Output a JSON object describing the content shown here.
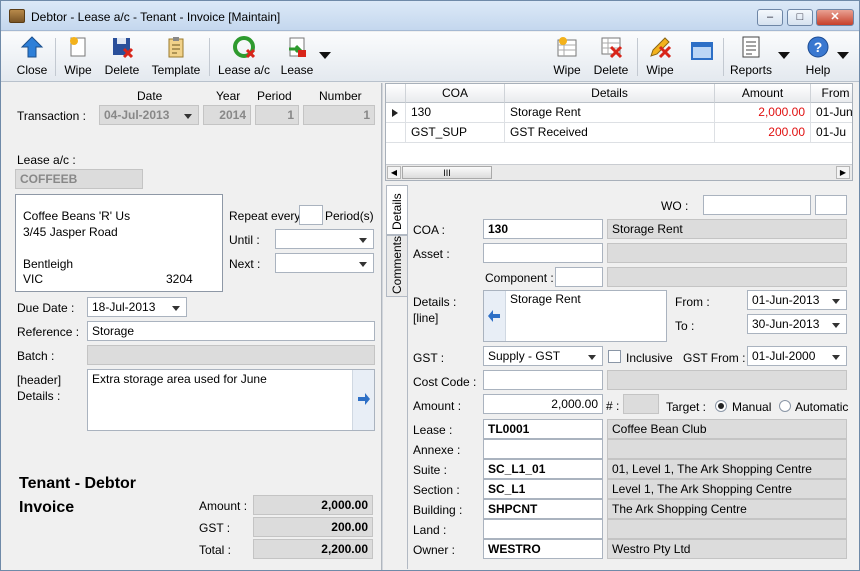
{
  "window": {
    "title": "Debtor - Lease a/c - Tenant - Invoice [Maintain]",
    "min": "–",
    "max": "□",
    "close": "✕"
  },
  "toolbar": {
    "close": "Close",
    "wipe": "Wipe",
    "delete": "Delete",
    "template": "Template",
    "lease_ac": "Lease a/c",
    "lease": "Lease",
    "line_wipe": "Wipe",
    "line_delete": "Delete",
    "wipe2": "Wipe",
    "reports": "Reports",
    "help": "Help"
  },
  "transaction": {
    "label": "Transaction :",
    "date_h": "Date",
    "year_h": "Year",
    "period_h": "Period",
    "number_h": "Number",
    "date": "04-Jul-2013",
    "year": "2014",
    "period": "1",
    "number": "1"
  },
  "lease_ac": {
    "label": "Lease a/c :",
    "value": "COFFEEB"
  },
  "address": {
    "line1": "Coffee Beans 'R' Us",
    "line2": "3/45 Jasper Road",
    "line3": "",
    "suburb": "Bentleigh",
    "state": "VIC",
    "postcode": "3204"
  },
  "repeat": {
    "label": "Repeat every",
    "value": "",
    "suffix": "Period(s)",
    "until_label": "Until :",
    "until": "",
    "next_label": "Next :",
    "next": ""
  },
  "due_date": {
    "label": "Due Date :",
    "value": "18-Jul-2013"
  },
  "reference": {
    "label": "Reference :",
    "value": "Storage"
  },
  "batch": {
    "label": "Batch :",
    "value": ""
  },
  "header_details": {
    "label1": "[header]",
    "label2": "Details :",
    "value": "Extra storage area used for June"
  },
  "doc_title": {
    "line1": "Tenant - Debtor",
    "line2": "Invoice"
  },
  "totals": {
    "amount_label": "Amount :",
    "amount": "2,000.00",
    "gst_label": "GST :",
    "gst": "200.00",
    "total_label": "Total :",
    "total": "2,200.00"
  },
  "grid": {
    "columns": [
      "COA",
      "Details",
      "Amount",
      "From"
    ],
    "rows": [
      {
        "coa": "130",
        "details": "Storage Rent",
        "amount": "2,000.00",
        "from": "01-Jun-"
      },
      {
        "coa": "GST_SUP",
        "details": "GST Received",
        "amount": "200.00",
        "from": "01-Ju"
      }
    ],
    "scroll_mid": "III"
  },
  "tabs": {
    "details": "Details",
    "comments": "Comments"
  },
  "line": {
    "wo_label": "WO :",
    "wo": "",
    "wo2": "",
    "coa_label": "COA :",
    "coa": "130",
    "coa_desc": "Storage Rent",
    "asset_label": "Asset :",
    "asset": "",
    "asset_desc": "",
    "component_label": "Component :",
    "component": "",
    "component_desc": "",
    "details_label1": "Details :",
    "details_label2": "[line]",
    "details": "Storage Rent",
    "from_label": "From :",
    "from": "01-Jun-2013",
    "to_label": "To :",
    "to": "30-Jun-2013",
    "gst_label": "GST :",
    "gst": "Supply - GST",
    "inclusive_label": "Inclusive",
    "gst_from_label": "GST From :",
    "gst_from": "01-Jul-2000",
    "cost_code_label": "Cost Code :",
    "cost_code": "",
    "cost_code_desc": "",
    "amount_label": "Amount :",
    "amount": "2,000.00",
    "hash_label": "# :",
    "hash": "",
    "target_label": "Target :",
    "manual_label": "Manual",
    "automatic_label": "Automatic",
    "lease_label": "Lease :",
    "lease": "TL0001",
    "lease_desc": "Coffee Bean Club",
    "annexe_label": "Annexe :",
    "annexe": "",
    "annexe_desc": "",
    "suite_label": "Suite :",
    "suite": "SC_L1_01",
    "suite_desc": "01, Level 1, The Ark Shopping Centre",
    "section_label": "Section :",
    "section": "SC_L1",
    "section_desc": "Level 1, The Ark Shopping Centre",
    "building_label": "Building :",
    "building": "SHPCNT",
    "building_desc": "The Ark Shopping Centre",
    "land_label": "Land :",
    "land": "",
    "land_desc": "",
    "owner_label": "Owner :",
    "owner": "WESTRO",
    "owner_desc": "Westro Pty Ltd"
  },
  "colors": {
    "accent_blue": "#2d6fc6",
    "amount_red": "#e01010"
  }
}
